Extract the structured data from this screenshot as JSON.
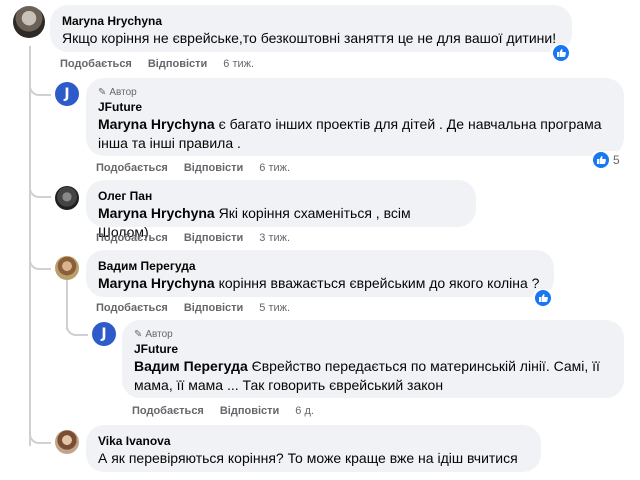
{
  "comments": [
    {
      "name": "Maryna Hrychyna",
      "text": "Якщо коріння не єврейське,то безкоштовні заняття це не для вашої дитини!",
      "like": "Подобається",
      "reply": "Відповісти",
      "time": "6 тиж."
    },
    {
      "author_tag": "Автор",
      "name": "JFuture",
      "mention": "Maryna Hrychyna",
      "text_line1": " є багато інших проектів для дітей . Де навчальна програма",
      "text_line2": "інша та інші правила .",
      "like": "Подобається",
      "reply": "Відповісти",
      "time": "6 тиж.",
      "reaction_count": "5"
    },
    {
      "name": "Олег Пан",
      "mention": "Maryna Hrychyna",
      "text": " Які коріння схаменіться , всім Шолом)",
      "like": "Подобається",
      "reply": "Відповісти",
      "time": "3 тиж."
    },
    {
      "name": "Вадим Перегуда",
      "mention": "Maryna Hrychyna",
      "text": " коріння вважається єврейським до якого коліна ?",
      "like": "Подобається",
      "reply": "Відповісти",
      "time": "5 тиж."
    },
    {
      "author_tag": "Автор",
      "name": "JFuture",
      "mention": "Вадим Перегуда",
      "text_line1": " Єврейство передається по материнській лінії. Самі, її",
      "text_line2": "мама, її мама ... Так говорить єврейський закон",
      "like": "Подобається",
      "reply": "Відповісти",
      "time": "6 д."
    },
    {
      "name": "Vika Ivanova",
      "text": "А як перевіряються коріння? То може краще вже на ідіш вчитися"
    }
  ],
  "colors": {
    "bubble": "#f0f2f5",
    "like_blue": "#1877f2",
    "jfuture_blue": "#2d5bc9",
    "secondary_text": "#65676b"
  }
}
